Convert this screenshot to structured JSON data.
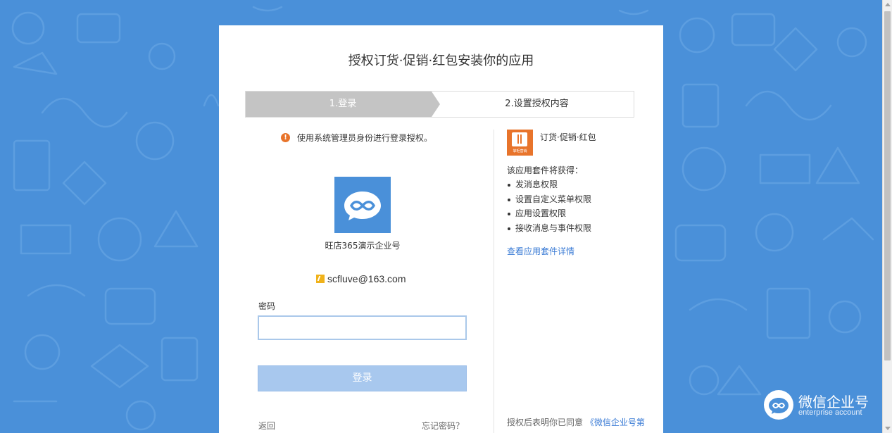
{
  "page": {
    "title": "授权订货·促销·红包安装你的应用"
  },
  "steps": [
    {
      "label": "1.登录"
    },
    {
      "label": "2.设置授权内容"
    }
  ],
  "login": {
    "notice": "使用系统管理员身份进行登录授权。",
    "corp_name": "旺店365演示企业号",
    "account_email": "scfluve@163.com",
    "password_label": "密码",
    "password_value": "",
    "login_button": "登录",
    "back_link": "返回",
    "forgot_link": "忘记密码？"
  },
  "app": {
    "name": "订货·促销·红包",
    "logo_caption": "掌柜营销",
    "permissions_heading": "该应用套件将获得：",
    "permissions": [
      "发消息权限",
      "设置自定义菜单权限",
      "应用设置权限",
      "接收消息与事件权限"
    ],
    "detail_link": "查看应用套件详情",
    "agreement_text": "授权后表明你已同意",
    "agreement_link": "《微信企业号第"
  },
  "brand": {
    "title": "微信企业号",
    "subtitle": "enterprise account"
  },
  "colors": {
    "background": "#4a90d9",
    "accent": "#3a7bd5",
    "warning": "#e8742b",
    "button_disabled": "#a8c8ee",
    "step_active": "#c4c4c4"
  },
  "icons": {
    "warning": "exclamation-circle-icon",
    "corp_logo": "wechat-work-logo-icon",
    "account": "account-bolt-icon",
    "app_logo": "app-logo-icon",
    "brand_logo": "wechat-work-brand-icon"
  }
}
